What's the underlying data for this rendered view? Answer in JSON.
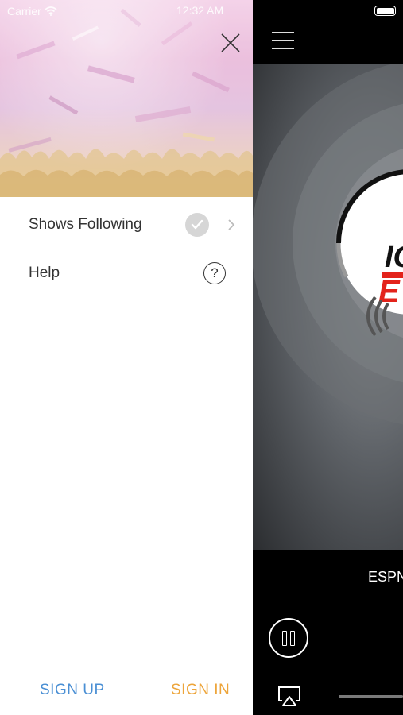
{
  "status_bar": {
    "carrier": "Carrier",
    "time": "12:32 AM",
    "wifi_icon": "wifi-icon",
    "battery_icon": "battery-icon"
  },
  "drawer": {
    "close_icon": "close-icon",
    "menu_items": [
      {
        "label": "Shows Following",
        "icon": "check-circle-icon",
        "trailing_icon": "chevron-right-icon"
      },
      {
        "label": "Help",
        "icon": "help-circle-icon"
      }
    ],
    "help_glyph": "?",
    "sign_up_label": "SIGN UP",
    "sign_in_label": "SIGN IN",
    "colors": {
      "sign_up": "#4a8fd4",
      "sign_in": "#eda53b"
    }
  },
  "player": {
    "menu_icon": "hamburger-menu-icon",
    "station_name": "ESPN",
    "logo_text_top": "IC",
    "logo_text_red": "E",
    "pause_icon": "pause-icon",
    "airplay_icon": "airplay-icon",
    "colors": {
      "logo_red": "#e3231b"
    }
  }
}
